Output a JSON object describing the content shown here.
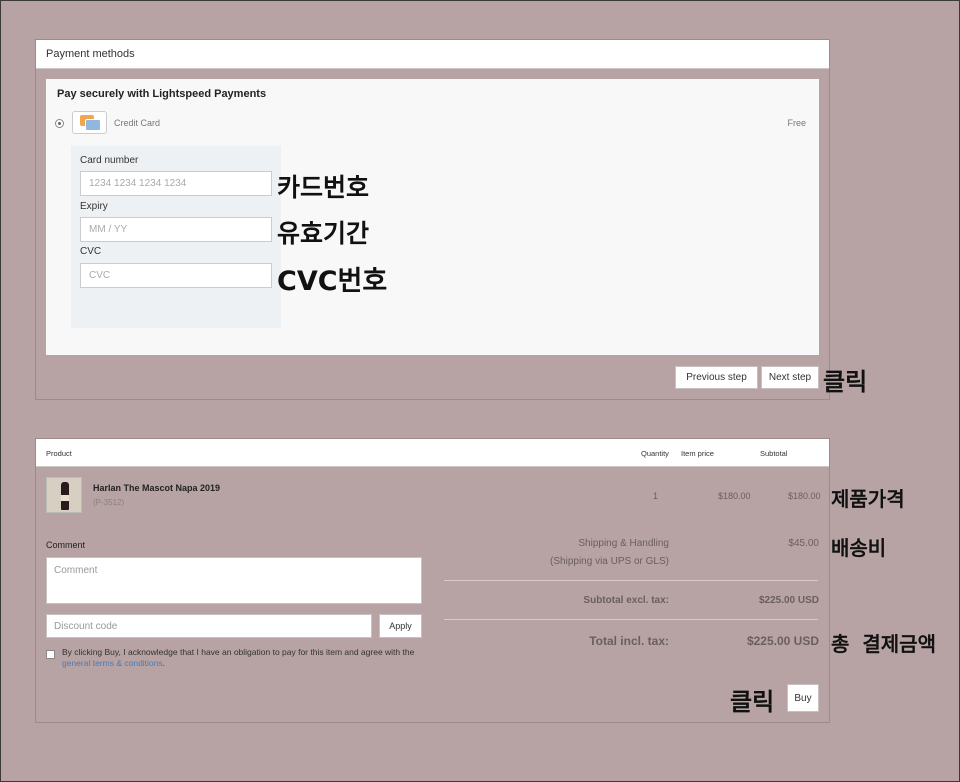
{
  "payment": {
    "header": "Payment methods",
    "title": "Pay securely with Lightspeed Payments",
    "method_label": "Credit Card",
    "method_price": "Free",
    "fields": [
      {
        "label": "Card number",
        "placeholder": "1234 1234 1234 1234"
      },
      {
        "label": "Expiry",
        "placeholder": "MM / YY"
      },
      {
        "label": "CVC",
        "placeholder": "CVC"
      }
    ],
    "prev_button": "Previous step",
    "next_button": "Next step"
  },
  "annotations": {
    "card_number": "카드번호",
    "expiry": "유효기간",
    "cvc": "CVC번호",
    "click_next": "클릭",
    "product_price": "제품가격",
    "shipping": "배송비",
    "total": "총 결제금액",
    "click_buy": "클릭"
  },
  "order": {
    "columns": {
      "product": "Product",
      "quantity": "Quantity",
      "item_price": "Item price",
      "subtotal": "Subtotal"
    },
    "item": {
      "name": "Harlan The Mascot Napa 2019",
      "sku": "(P-3512)",
      "quantity": "1",
      "price": "$180.00",
      "subtotal": "$180.00"
    },
    "shipping_label": "Shipping & Handling",
    "shipping_sub": "(Shipping via UPS or GLS)",
    "shipping_value": "$45.00",
    "subtotal_label": "Subtotal excl. tax:",
    "subtotal_value": "$225.00 USD",
    "total_label": "Total incl. tax:",
    "total_value": "$225.00 USD",
    "comment_label": "Comment",
    "comment_placeholder": "Comment",
    "discount_placeholder": "Discount code",
    "apply_button": "Apply",
    "terms_text": "By clicking Buy, I acknowledge that I have an obligation to pay for this item and agree with the ",
    "terms_link": "general terms & conditions",
    "terms_end": ".",
    "buy_button": "Buy"
  }
}
